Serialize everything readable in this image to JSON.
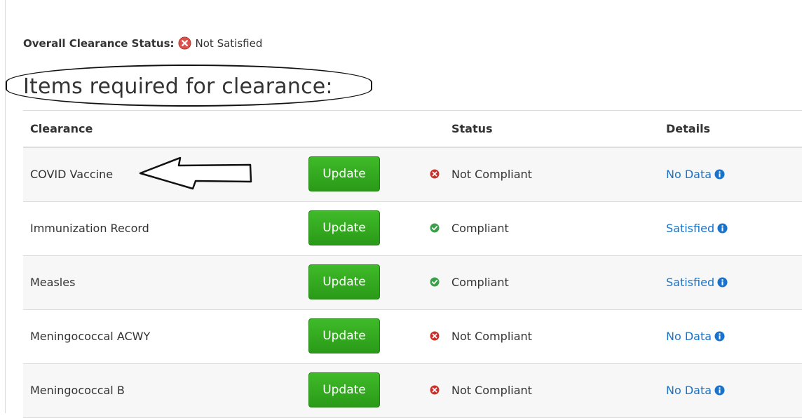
{
  "overall": {
    "label": "Overall Clearance Status:",
    "status_icon": "x-circle-icon",
    "value": "Not Satisfied",
    "fail_color": "#d9534f"
  },
  "heading": "Items required for clearance:",
  "table": {
    "headers": {
      "clearance": "Clearance",
      "status": "Status",
      "details": "Details"
    },
    "rows": [
      {
        "name": "COVID Vaccine",
        "button": "Update",
        "status": "Not Compliant",
        "status_icon": "x-circle-icon",
        "details": "No Data",
        "details_icon": "info-icon"
      },
      {
        "name": "Immunization Record",
        "button": "Update",
        "status": "Compliant",
        "status_icon": "check-circle-icon",
        "details": "Satisfied",
        "details_icon": "info-icon"
      },
      {
        "name": "Measles",
        "button": "Update",
        "status": "Compliant",
        "status_icon": "check-circle-icon",
        "details": "Satisfied",
        "details_icon": "info-icon"
      },
      {
        "name": "Meningococcal ACWY",
        "button": "Update",
        "status": "Not Compliant",
        "status_icon": "x-circle-icon",
        "details": "No Data",
        "details_icon": "info-icon"
      },
      {
        "name": "Meningococcal B",
        "button": "Update",
        "status": "Not Compliant",
        "status_icon": "x-circle-icon",
        "details": "No Data",
        "details_icon": "info-icon"
      }
    ]
  },
  "colors": {
    "button_green": "#2fa71c",
    "link_blue": "#1a73c8",
    "ok_green": "#3aa14a",
    "fail_red": "#c9302c"
  }
}
